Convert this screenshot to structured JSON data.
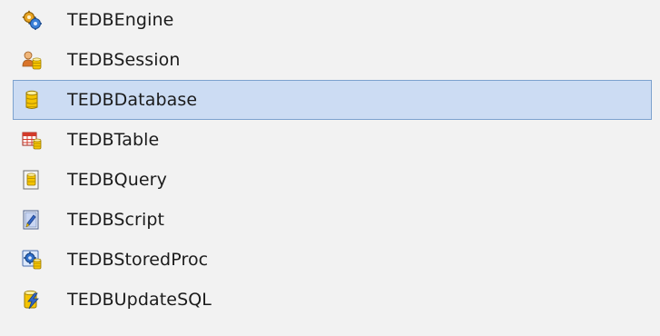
{
  "components": [
    {
      "label": "TEDBEngine",
      "icon": "engine-gears-icon",
      "selected": false
    },
    {
      "label": "TEDBSession",
      "icon": "session-users-icon",
      "selected": false
    },
    {
      "label": "TEDBDatabase",
      "icon": "database-cylinder-icon",
      "selected": true
    },
    {
      "label": "TEDBTable",
      "icon": "table-grid-icon",
      "selected": false
    },
    {
      "label": "TEDBQuery",
      "icon": "query-document-icon",
      "selected": false
    },
    {
      "label": "TEDBScript",
      "icon": "script-document-icon",
      "selected": false
    },
    {
      "label": "TEDBStoredProc",
      "icon": "stored-proc-gear-icon",
      "selected": false
    },
    {
      "label": "TEDBUpdateSQL",
      "icon": "update-sql-lightning-icon",
      "selected": false
    }
  ],
  "colors": {
    "background": "#f2f2f2",
    "selection_fill": "#ccdcf3",
    "selection_border": "#7da2ce",
    "text": "#1b1b1b",
    "db_yellow": "#f5c400",
    "table_red": "#d23a2a",
    "gear_blue": "#2f6fc9"
  }
}
